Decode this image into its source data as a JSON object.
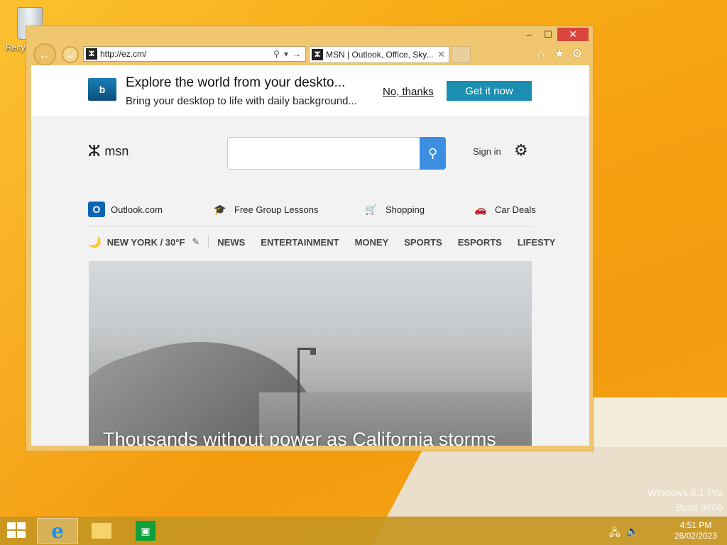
{
  "desktop": {
    "recycle_bin_label": "Recyc",
    "watermark_line1": "Windows 8.1 Pro",
    "watermark_line2": "Build 9600"
  },
  "window": {
    "minimize_glyph": "–",
    "maximize_glyph": "☐",
    "close_glyph": "✕"
  },
  "browser": {
    "back_glyph": "←",
    "forward_glyph": "→",
    "address": "http://ez.cm/",
    "favicon_glyph": "ⵣ",
    "search_glyph": "⚲",
    "dropdown_glyph": "▾",
    "go_glyph": "→",
    "tab_title": "MSN | Outlook, Office, Sky...",
    "tab_close_glyph": "✕",
    "home_icon": "⌂",
    "favorites_icon": "★",
    "tools_icon": "⚙"
  },
  "banner": {
    "icon_text": "b",
    "title": "Explore the world from your deskto...",
    "subtitle": "Bring your desktop to life with daily background...",
    "no_thanks": "No, thanks",
    "get_it": "Get it now"
  },
  "msn": {
    "logo_glyph": "ⵣ",
    "logo_text": "msn",
    "search_placeholder": "",
    "search_glyph": "⚲",
    "sign_in": "Sign in",
    "settings_glyph": "⚙"
  },
  "quick_links": [
    {
      "label": "Outlook.com",
      "glyph": "O",
      "color": "#0a64b4"
    },
    {
      "label": "Free Group Lessons",
      "glyph": "🎓",
      "color": "#7a3fa8"
    },
    {
      "label": "Shopping",
      "glyph": "🛒",
      "color": "#1676d2"
    },
    {
      "label": "Car Deals",
      "glyph": "🚗",
      "color": "#1d5fa8"
    }
  ],
  "nav": {
    "weather_icon": "🌙",
    "location": "NEW YORK / 30°F",
    "edit_icon": "✎",
    "items": [
      "NEWS",
      "ENTERTAINMENT",
      "MONEY",
      "SPORTS",
      "ESPORTS",
      "LIFESTY"
    ]
  },
  "hero": {
    "caption": "Thousands without power as California storms"
  },
  "taskbar": {
    "ie_glyph": "e",
    "store_glyph": "▣",
    "network_icon": "🖧",
    "volume_icon": "🔈",
    "time": "4:51 PM",
    "date": "26/02/2023"
  }
}
